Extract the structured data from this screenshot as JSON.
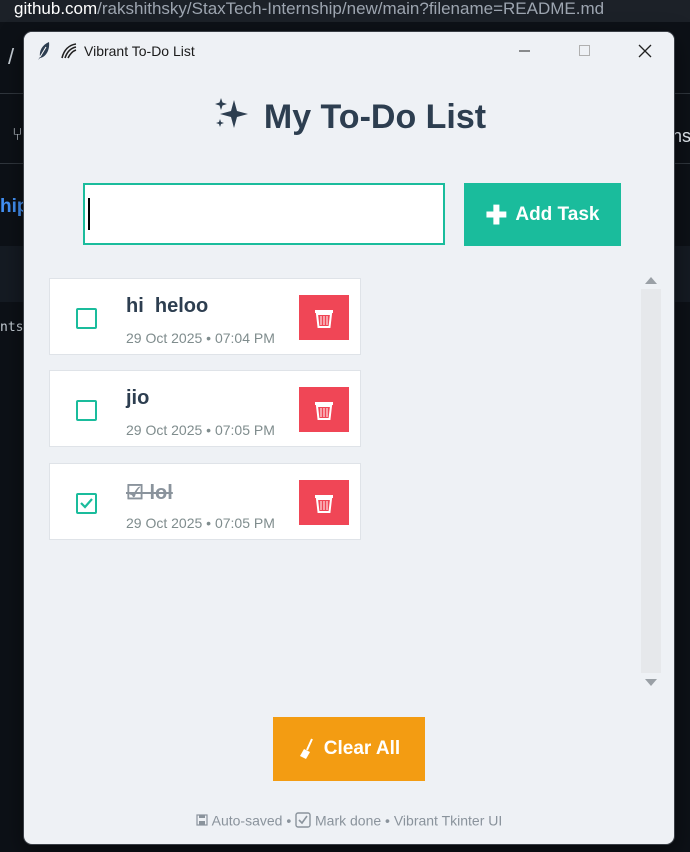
{
  "browser": {
    "url_host": "github.com",
    "url_path": "/rakshithsky/StaxTech-Internship/new/main?filename=README.md",
    "fragment_slash": "/",
    "fragment_nip": "hip",
    "fragment_nsi": "nsi",
    "fragment_nts": "nts"
  },
  "window": {
    "title": "Vibrant To-Do List"
  },
  "app": {
    "heading": "My To-Do List",
    "input_value": "",
    "add_button_label": "Add Task",
    "clear_button_label": "Clear All",
    "footer": {
      "autosaved": "Auto-saved •",
      "mark_done": "Mark done • Vibrant Tkinter UI"
    }
  },
  "tasks": [
    {
      "text": "hi  heloo",
      "timestamp": "29 Oct 2025 • 07:04 PM",
      "done": false
    },
    {
      "text": "jio",
      "timestamp": "29 Oct 2025 • 07:05 PM",
      "done": false
    },
    {
      "text": "☑ lol",
      "timestamp": "29 Oct 2025 • 07:05 PM",
      "done": true
    }
  ],
  "colors": {
    "accent": "#1abc9c",
    "delete": "#f04656",
    "clear": "#f39c12",
    "heading": "#2d3e50"
  },
  "icons": {
    "heading": "sparkles-icon",
    "add": "plus-icon",
    "delete": "trash-icon",
    "clear": "broom-icon",
    "footer_save": "floppy-disk-icon",
    "footer_check": "checkbox-icon"
  }
}
